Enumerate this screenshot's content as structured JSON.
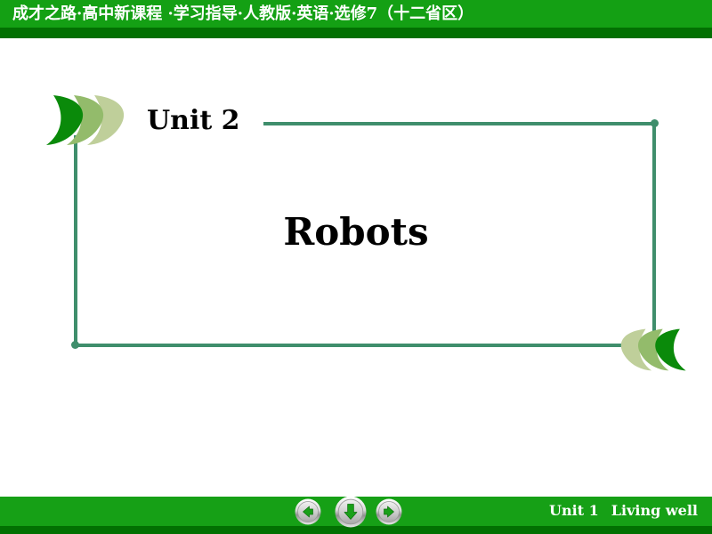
{
  "header": {
    "title": "成才之路·高中新课程 ·学习指导·人教版·英语·选修7（十二省区）",
    "bg_color": "#14A014",
    "shadow_color": "#027002"
  },
  "slide": {
    "unit_label": "Unit 2",
    "topic_title": "Robots",
    "frame_color": "#3F8E6C",
    "crescent_colors": [
      "#0A8A0A",
      "#93BB6B",
      "#BFCF9A"
    ]
  },
  "footer": {
    "caption_unit": "Unit 1",
    "caption_topic": "Living well",
    "bg_color": "#16A016",
    "shadow_color": "#027002",
    "buttons": [
      {
        "name": "previous-slide-button",
        "icon": "arrow-left-icon",
        "label": "Previous"
      },
      {
        "name": "down-slide-button",
        "icon": "arrow-down-icon",
        "label": "Down"
      },
      {
        "name": "next-slide-button",
        "icon": "arrow-right-icon",
        "label": "Next"
      }
    ]
  }
}
